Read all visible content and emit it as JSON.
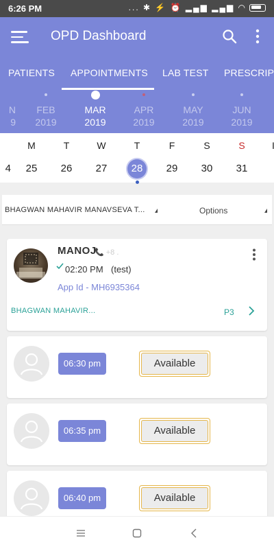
{
  "status_bar": {
    "time": "6:26 PM",
    "icons_text": "... ✱ ⚡ ⏰ ▂▄▆ ▂▄▆ ◠"
  },
  "app_bar": {
    "title": "OPD Dashboard",
    "menu_icon": "hamburger-menu-icon",
    "search_icon": "search-icon",
    "overflow_icon": "kebab-icon"
  },
  "tabs": [
    "PATIENTS",
    "APPOINTMENTS",
    "LAB TEST",
    "PRESCRIPT"
  ],
  "active_tab": "APPOINTMENTS",
  "months": [
    {
      "name": "N",
      "year": "9"
    },
    {
      "name": "FEB",
      "year": "2019"
    },
    {
      "name": "MAR",
      "year": "2019"
    },
    {
      "name": "APR",
      "year": "2019"
    },
    {
      "name": "MAY",
      "year": "2019"
    },
    {
      "name": "JUN",
      "year": "2019"
    }
  ],
  "active_month": "MAR",
  "week": [
    {
      "name": "",
      "date": "4"
    },
    {
      "name": "M",
      "date": "25"
    },
    {
      "name": "T",
      "date": "26"
    },
    {
      "name": "W",
      "date": "27"
    },
    {
      "name": "T",
      "date": "28"
    },
    {
      "name": "F",
      "date": "29"
    },
    {
      "name": "S",
      "date": "30"
    },
    {
      "name": "S",
      "date": "31"
    },
    {
      "name": "I",
      "date": ""
    }
  ],
  "selected_date": "28",
  "filter": {
    "hospital": "BHAGWAN MAHAVIR MANAVSEVA T...",
    "options": "Options"
  },
  "appointment": {
    "name": "MANOJ",
    "faded_text": "📞 +8 .",
    "time": "02:20 PM",
    "note": "(test)",
    "app_id": "App Id - MH6935364",
    "hospital": "BHAGWAN MAHAVIR...",
    "priority": "P3"
  },
  "slots": [
    {
      "time": "06:30 pm",
      "status": "Available"
    },
    {
      "time": "06:35 pm",
      "status": "Available"
    },
    {
      "time": "06:40 pm",
      "status": "Available"
    }
  ],
  "colors": {
    "primary": "#7b86d8",
    "teal": "#2aa197",
    "available_border": "#e5b64a",
    "sunday": "#c62828"
  }
}
